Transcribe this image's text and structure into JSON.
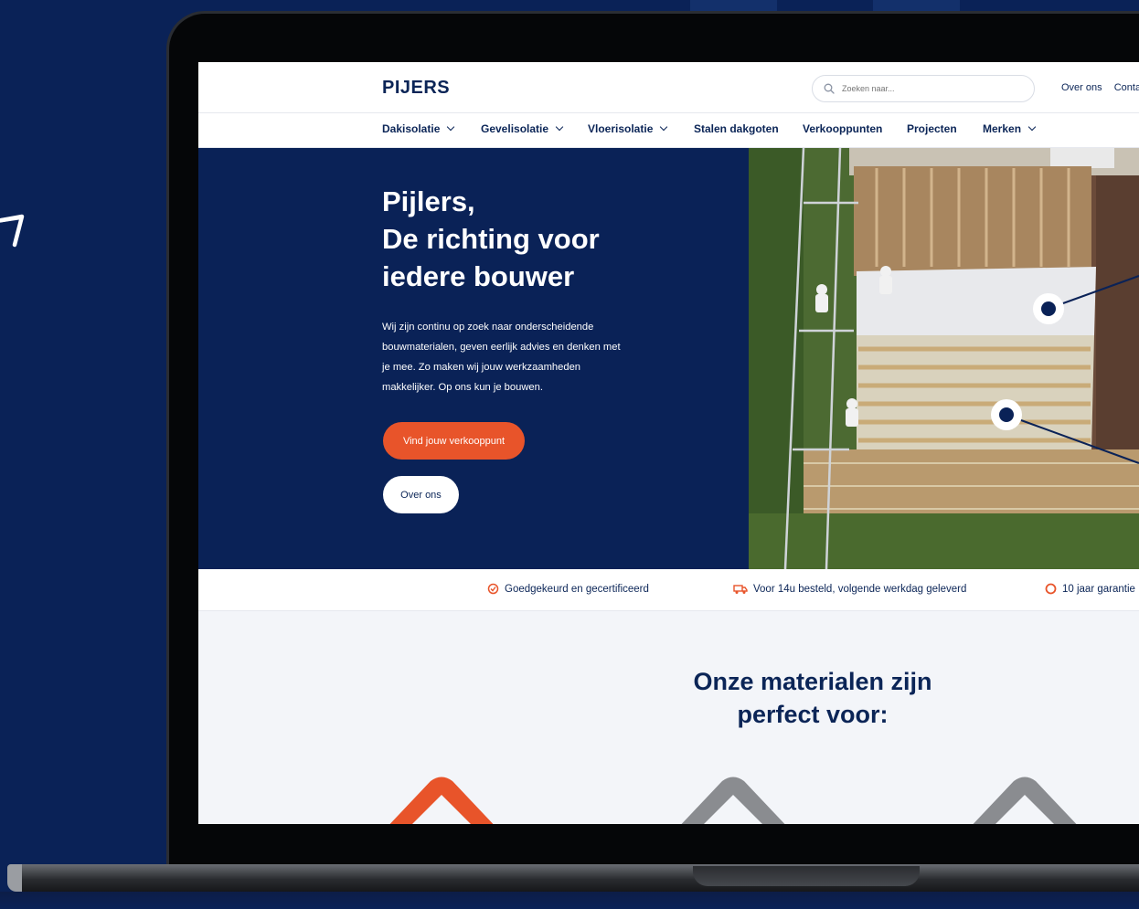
{
  "site": {
    "logo": "PIJERS",
    "search": {
      "placeholder": "Zoeken naar..."
    },
    "top_links": [
      "Over ons",
      "Contac"
    ]
  },
  "nav": {
    "items": [
      {
        "label": "Dakisolatie",
        "dropdown": true
      },
      {
        "label": "Gevelisolatie",
        "dropdown": true
      },
      {
        "label": "Vloerisolatie",
        "dropdown": true
      },
      {
        "label": "Stalen dakgoten",
        "dropdown": false
      },
      {
        "label": "Verkooppunten",
        "dropdown": false
      },
      {
        "label": "Projecten",
        "dropdown": false
      },
      {
        "label": "Merken",
        "dropdown": true
      }
    ]
  },
  "hero": {
    "title_line1": "Pijlers,",
    "title_line2": "De richting voor",
    "title_line3": "iedere bouwer",
    "text": "Wij zijn continu op zoek naar onderscheidende bouwmaterialen, geven eerlijk advies en denken met je mee. Zo maken wij jouw werkzaamheden makkelijker. Op ons kun je bouwen.",
    "primary_button": "Vind jouw verkooppunt",
    "secondary_button": "Over ons"
  },
  "usps": [
    {
      "icon": "certificate-icon",
      "label": "Goedgekeurd en gecertificeerd"
    },
    {
      "icon": "delivery-icon",
      "label": "Voor 14u besteld, volgende werkdag geleverd"
    },
    {
      "icon": "warranty-icon",
      "label": "10 jaar garantie"
    }
  ],
  "materials": {
    "title_line1": "Onze materialen zijn",
    "title_line2": "perfect voor:"
  },
  "colors": {
    "navy": "#0a2257",
    "accent": "#e8542a",
    "light_bg": "#f3f5f9"
  }
}
